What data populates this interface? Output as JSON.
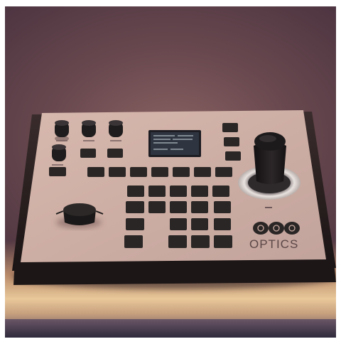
{
  "device": {
    "brand_text": "OPTICS",
    "colors": {
      "panel": "#c9aaa1",
      "key": "#2a2626",
      "knob": "#1e1c1d",
      "screen": "#2e3540",
      "backdrop": "#6b4a50",
      "floor_glow": "#e9c89a"
    }
  }
}
